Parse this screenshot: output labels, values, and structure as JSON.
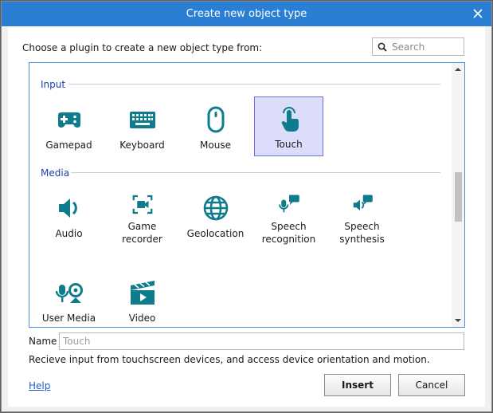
{
  "dialog": {
    "title": "Create new object type",
    "close_icon": "close-icon",
    "prompt": "Choose a plugin to create a new object type from:",
    "search": {
      "placeholder": "Search",
      "value": ""
    }
  },
  "categories": [
    {
      "name": "Input",
      "plugins": [
        {
          "label": "Gamepad",
          "icon": "gamepad-icon",
          "selected": false
        },
        {
          "label": "Keyboard",
          "icon": "keyboard-icon",
          "selected": false
        },
        {
          "label": "Mouse",
          "icon": "mouse-icon",
          "selected": false
        },
        {
          "label": "Touch",
          "icon": "touch-icon",
          "selected": true
        }
      ]
    },
    {
      "name": "Media",
      "plugins": [
        {
          "label": "Audio",
          "icon": "audio-icon",
          "selected": false
        },
        {
          "label": "Game recorder",
          "icon": "game-recorder-icon",
          "selected": false
        },
        {
          "label": "Geolocation",
          "icon": "globe-icon",
          "selected": false
        },
        {
          "label": "Speech recognition",
          "icon": "speech-recognition-icon",
          "selected": false
        },
        {
          "label": "Speech synthesis",
          "icon": "speech-synthesis-icon",
          "selected": false
        },
        {
          "label": "User Media",
          "icon": "user-media-icon",
          "selected": false
        },
        {
          "label": "Video",
          "icon": "video-icon",
          "selected": false
        }
      ]
    }
  ],
  "name_field": {
    "label": "Name",
    "value": "",
    "placeholder": "Touch"
  },
  "description": "Recieve input from touchscreen devices, and access device orientation and motion.",
  "footer": {
    "help": "Help",
    "insert": "Insert",
    "cancel": "Cancel"
  },
  "colors": {
    "titlebar": "#2a7fd4",
    "icon": "#0e7c8c",
    "category": "#1e3fa8",
    "selected_bg": "#dcdcfb"
  }
}
